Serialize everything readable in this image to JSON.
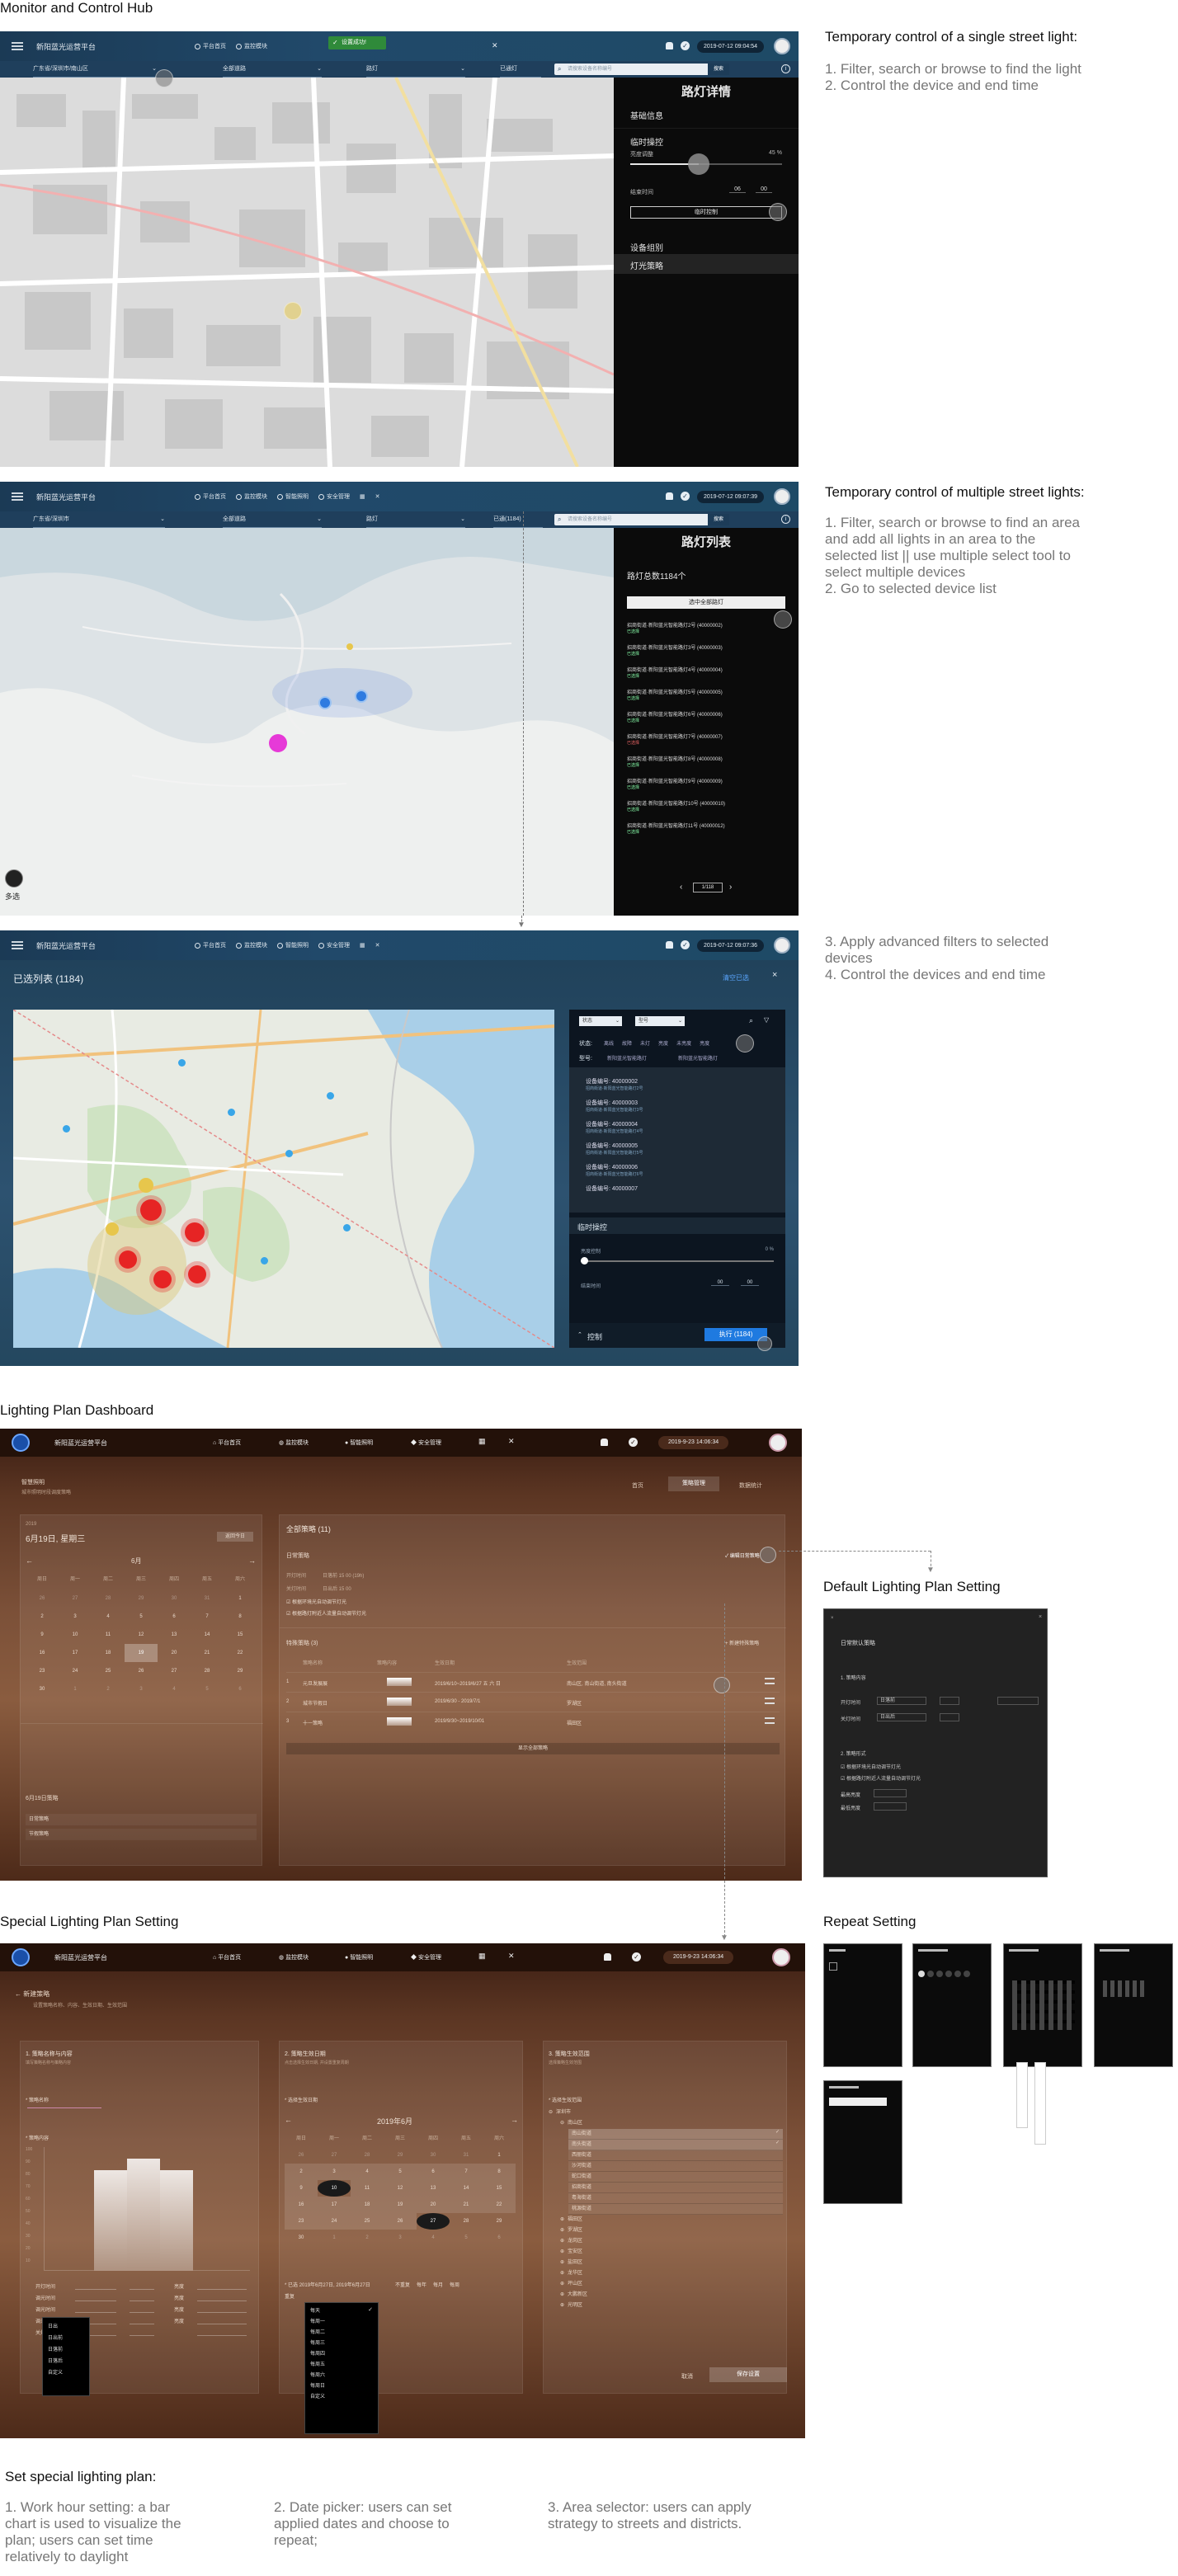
{
  "sections": {
    "monitor_title": "Monitor and Control Hub",
    "dashboard_title": "Lighting Plan Dashboard",
    "special_title": "Special Lighting Plan Setting",
    "default_setting_title": "Default Lighting Plan Setting",
    "repeat_setting_title": "Repeat Setting"
  },
  "descriptions": {
    "single_heading": "Temporary control of a single street light:",
    "single_steps": "1. Filter, search or browse to find the light\n2. Control the device and end time",
    "multi_heading": "Temporary control of multiple street lights:",
    "multi_steps": "1. Filter, search or browse to find an area\nand add all lights in an area to the\nselected list || use multiple select tool to\nselect multiple devices\n2. Go to selected device list",
    "selected_steps": "3. Apply advanced filters to selected\ndevices\n4. Control the devices and end time",
    "special_heading": "Set special lighting plan:",
    "special_1": "1. Work hour setting: a bar\nchart is used to visualize the\nplan; users can set time\nrelatively to daylight",
    "special_2": "2. Date picker: users can set\napplied dates and choose to\nrepeat;",
    "special_3": "3. Area selector: users can apply\nstrategy to streets and districts."
  },
  "app": {
    "title": "新阳蓝光运营平台",
    "nav": [
      "平台首页",
      "监控模块",
      "智能照明",
      "安全管理"
    ],
    "toast": "设置成功!",
    "time_1": "2019-07-12 09:04:54",
    "time_2": "2019-07-12 09:07:39",
    "time_3": "2019-07-12 09:07:36",
    "time_4": "2019-9-23 14:06:34",
    "filter_region": "广东省/深圳市/南山区",
    "filter_region_2": "广东省/深圳市",
    "filter_street": "全部道路",
    "filter_type": "路灯",
    "filter_status": "已通灯",
    "filter_status_2": "已通(1184)",
    "search_placeholder": "请搜索设备名称编号",
    "search_button": "搜索"
  },
  "screen1": {
    "panel_title": "路灯详情",
    "basic_info": "基础信息",
    "temp_control": "临时操控",
    "brightness_label": "亮度调整",
    "brightness_value": "45 %",
    "brightness_level": 0.45,
    "end_time_label": "结束时间",
    "end_hour": "06",
    "end_min": "00",
    "control_button": "临时控制",
    "device_group": "设备组别",
    "light_strategy": "灯光策略"
  },
  "screen2": {
    "panel_title": "路灯列表",
    "total": "路灯总数1184个",
    "select_all": "选中全部路灯",
    "lights": [
      {
        "name": "招商街道·新阳蓝光智能路灯2号 (40000002)",
        "sub": "已选择"
      },
      {
        "name": "招商街道·新阳蓝光智能路灯3号 (40000003)",
        "sub": "已选择"
      },
      {
        "name": "招商街道·新阳蓝光智能路灯4号 (40000004)",
        "sub": "已选择"
      },
      {
        "name": "招商街道·新阳蓝光智能路灯5号 (40000005)",
        "sub": "已选择"
      },
      {
        "name": "招商街道·新阳蓝光智能路灯6号 (40000006)",
        "sub": "已选择"
      },
      {
        "name": "招商街道·新阳蓝光智能路灯7号 (40000007)",
        "sub": "已选择"
      },
      {
        "name": "招商街道·新阳蓝光智能路灯8号 (40000008)",
        "sub": "已选择"
      },
      {
        "name": "招商街道·新阳蓝光智能路灯9号 (40000009)",
        "sub": "已选择"
      },
      {
        "name": "招商街道·新阳蓝光智能路灯10号 (40000010)",
        "sub": "已选择"
      },
      {
        "name": "招商街道·新阳蓝光智能路灯11号 (40000012)",
        "sub": "已选择"
      }
    ],
    "page": "1/118",
    "multi_select": "多选"
  },
  "screen3": {
    "title": "已选列表 (1184)",
    "clear": "清空已选",
    "filter_a": "状态",
    "filter_b": "型号",
    "status_label": "状态:",
    "status_options": [
      "离线",
      "故障",
      "未灯",
      "亮度",
      "未亮度",
      "亮度"
    ],
    "model_label": "型号:",
    "model_options": [
      "新阳蓝光智能路灯",
      "新阳蓝光智能路灯"
    ],
    "devices": [
      {
        "id": "设备编号: 40000002",
        "sub": "招商街道·新阳蓝光智能路灯2号"
      },
      {
        "id": "设备编号: 40000003",
        "sub": "招商街道·新阳蓝光智能路灯3号"
      },
      {
        "id": "设备编号: 40000004",
        "sub": "招商街道·新阳蓝光智能路灯4号"
      },
      {
        "id": "设备编号: 40000005",
        "sub": "招商街道·新阳蓝光智能路灯5号"
      },
      {
        "id": "设备编号: 40000006",
        "sub": "招商街道·新阳蓝光智能路灯6号"
      },
      {
        "id": "设备编号: 40000007",
        "sub": ""
      }
    ],
    "temp_control": "临时操控",
    "brightness_label": "亮度控制",
    "brightness_value": "0 %",
    "end_time_label": "结束时间",
    "end_hour": "00",
    "end_min": "00",
    "control_label": "控制",
    "execute": "执行 (1184)"
  },
  "dashboard": {
    "crumb": "智慧照明",
    "crumb_sub": "城市照明时段调度策略",
    "tabs": [
      "首页",
      "策略管理",
      "数据统计"
    ],
    "year": "2019",
    "date": "6月19日, 星期三",
    "today_button": "返回今日",
    "month": "6月",
    "weekdays": [
      "周日",
      "周一",
      "周二",
      "周三",
      "周四",
      "周五",
      "周六"
    ],
    "days": [
      "26",
      "27",
      "28",
      "29",
      "30",
      "31",
      "1",
      "2",
      "3",
      "4",
      "5",
      "6",
      "7",
      "8",
      "9",
      "10",
      "11",
      "12",
      "13",
      "14",
      "15",
      "16",
      "17",
      "18",
      "19",
      "20",
      "21",
      "22",
      "23",
      "24",
      "25",
      "26",
      "27",
      "28",
      "29",
      "30",
      "1",
      "2",
      "3",
      "4",
      "5",
      "6"
    ],
    "day_plan_title": "6月19日策略",
    "day_plan_items": [
      "日常策略",
      "节假策略"
    ],
    "all_plans": "全部策略 (11)",
    "default_plan": "日常策略",
    "edit_default": "编辑日常策略",
    "on_time_label": "开灯时间",
    "on_time_value": "日落前  15  00  (19h)",
    "off_time_label": "关灯时间",
    "off_time_value": "日出后  15  00",
    "check_1": "根据环境光自动调节灯光",
    "check_2": "根据路灯附近人流量自动调节灯光",
    "special_plans": "特殊策略 (3)",
    "new_special": "+ 新建特殊策略",
    "table_headers": [
      "",
      "策略名称",
      "策略内容",
      "生效日期",
      "生效范围",
      ""
    ],
    "table_rows": [
      {
        "no": "1",
        "name": "元旦发展展",
        "date": "2019/6/10~2019/6/27 五 六 日",
        "range": "南山区, 南山街道, 南头街道"
      },
      {
        "no": "2",
        "name": "城市节假日",
        "date": "2019/6/30 - 2019/7/1",
        "range": "罗湖区"
      },
      {
        "no": "3",
        "name": "十一策略",
        "date": "2019/9/30~2019/10/01",
        "range": "福田区"
      }
    ],
    "show_all": "显示全部策略"
  },
  "default_modal": {
    "title": "日常默认策略",
    "name_label": "1. 策略内容",
    "on_label": "开灯时间",
    "on_value": "日落前",
    "off_label": "关灯时间",
    "off_value": "日出后",
    "sub2": "2. 策略形式",
    "check_1": "根据环境光自动调节灯光",
    "check_2": "根据路灯附近人流量自动调节灯光",
    "max_label": "最高亮度",
    "min_label": "最低亮度"
  },
  "special": {
    "back": "新建策略",
    "back_sub": "设置策略名称、内容、生效日期、生效范围",
    "col1_title": "1. 策略名称与内容",
    "col1_sub": "填写策略名称与策略内容",
    "name_label": "* 策略名称",
    "content_label": "* 策略内容",
    "y_ticks": [
      "100",
      "90",
      "80",
      "70",
      "60",
      "50",
      "40",
      "30",
      "20",
      "10"
    ],
    "rows": [
      {
        "label": "开灯时间",
        "tag": "亮度"
      },
      {
        "label": "调光时间",
        "tag": "亮度"
      },
      {
        "label": "调光时间",
        "tag": "亮度"
      },
      {
        "label": "调光时间",
        "tag": "亮度"
      },
      {
        "label": "关灯时间",
        "tag": ""
      }
    ],
    "dropdown_1": [
      "日出",
      "日出前",
      "日落前",
      "日落后",
      "自定义"
    ],
    "col2_title": "2. 策略生效日期",
    "col2_sub": "点击选择生效日期, 并设置重复周期",
    "date_label": "* 选择生效日期",
    "calendar_title": "2019年6月",
    "cal_weekdays": [
      "周日",
      "周一",
      "周二",
      "周三",
      "周四",
      "周五",
      "周六"
    ],
    "cal_days": [
      "26",
      "27",
      "28",
      "29",
      "30",
      "31",
      "1",
      "2",
      "3",
      "4",
      "5",
      "6",
      "7",
      "8",
      "9",
      "10",
      "11",
      "12",
      "13",
      "14",
      "15",
      "16",
      "17",
      "18",
      "19",
      "20",
      "21",
      "22",
      "23",
      "24",
      "25",
      "26",
      "27",
      "28",
      "29",
      "30",
      "1",
      "2",
      "3",
      "4",
      "5",
      "6"
    ],
    "selected_label": "* 已选",
    "selected_value": "2019年6月27日, 2019年6月27日",
    "repeat_label": "重复",
    "repeat_opts": [
      "不重复",
      "每年",
      "每月",
      "每周"
    ],
    "dropdown_2": [
      "每天",
      "每周一",
      "每周二",
      "每周三",
      "每周四",
      "每周五",
      "每周六",
      "每周日",
      "自定义"
    ],
    "col3_title": "3. 策略生效范围",
    "col3_sub": "选择策略生效范围",
    "area_label": "* 选择生效范围",
    "tree": [
      {
        "name": "深圳市",
        "level": 0,
        "checked": true
      },
      {
        "name": "南山区",
        "level": 1,
        "checked": true
      },
      {
        "name": "南山街道",
        "level": 2,
        "checked": true
      },
      {
        "name": "南头街道",
        "level": 2,
        "checked": true
      },
      {
        "name": "西丽街道",
        "level": 2,
        "checked": false
      },
      {
        "name": "沙河街道",
        "level": 2,
        "checked": false
      },
      {
        "name": "蛇口街道",
        "level": 2,
        "checked": false
      },
      {
        "name": "招商街道",
        "level": 2,
        "checked": false
      },
      {
        "name": "粤海街道",
        "level": 2,
        "checked": false
      },
      {
        "name": "桃源街道",
        "level": 2,
        "checked": false
      },
      {
        "name": "福田区",
        "level": 1,
        "checked": false
      },
      {
        "name": "罗湖区",
        "level": 1,
        "checked": false
      },
      {
        "name": "龙岗区",
        "level": 1,
        "checked": false
      },
      {
        "name": "宝安区",
        "level": 1,
        "checked": false
      },
      {
        "name": "盐田区",
        "level": 1,
        "checked": false
      },
      {
        "name": "龙华区",
        "level": 1,
        "checked": false
      },
      {
        "name": "坪山区",
        "level": 1,
        "checked": false
      },
      {
        "name": "大鹏新区",
        "level": 1,
        "checked": false
      },
      {
        "name": "光明区",
        "level": 1,
        "checked": false
      }
    ],
    "cancel": "取消",
    "save": "保存设置"
  },
  "colors": {
    "blue_dark": "#1b3a55",
    "brown": "#7b5038",
    "accent_blue": "#1f7ae0",
    "marker_red": "#e62424",
    "marker_magenta": "#e63ad8"
  }
}
